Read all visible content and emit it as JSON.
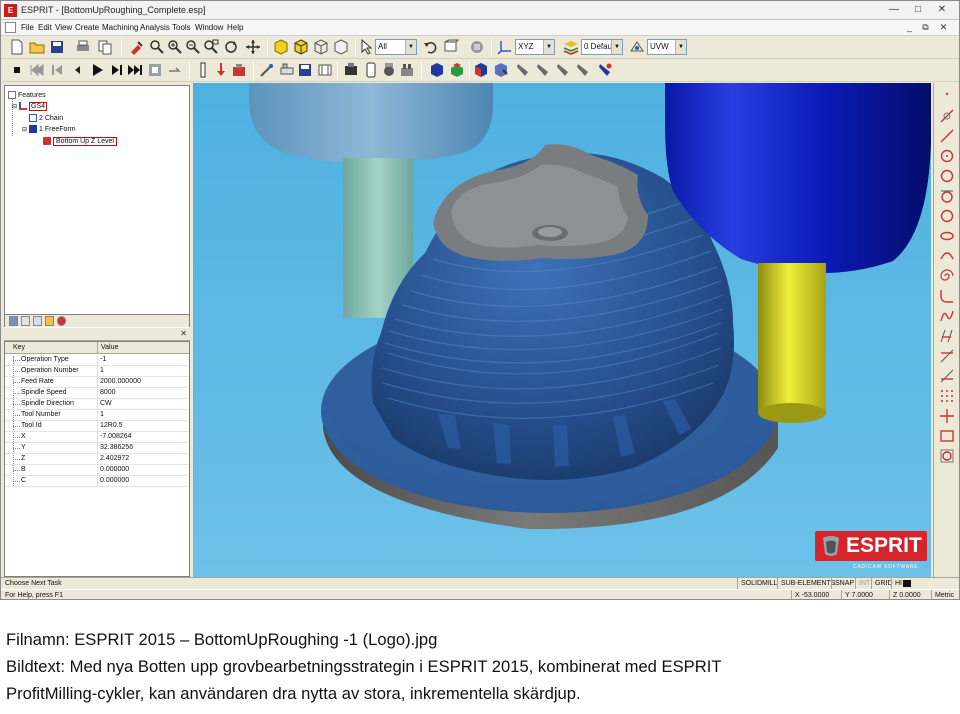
{
  "window": {
    "title": "ESPRIT - [BottomUpRoughing_Complete.esp]",
    "app_icon": "esprit-app-icon",
    "controls": [
      "minimize",
      "maximize",
      "close"
    ]
  },
  "menu": {
    "items": [
      "File",
      "Edit",
      "View",
      "Create",
      "Machining",
      "Analysis",
      "Tools",
      "Window",
      "Help"
    ]
  },
  "toolbar": {
    "filter_combo": "All",
    "plane_combo": "XYZ",
    "layer_combo": "0 Defau",
    "workplane_combo": "UVW"
  },
  "feature_tree": {
    "root": "Features",
    "nodes": [
      "GS4",
      "2 Chain",
      "1 FreeForm",
      "Bottom Up Z Level"
    ]
  },
  "property_grid": {
    "key_header": "Key",
    "value_header": "Value",
    "rows": [
      {
        "key": "Operation Type",
        "value": "-1"
      },
      {
        "key": "Operation Number",
        "value": "1"
      },
      {
        "key": "Feed Rate",
        "value": "2000.000000"
      },
      {
        "key": "Spindle Speed",
        "value": "8000"
      },
      {
        "key": "Spindle Direction",
        "value": "CW"
      },
      {
        "key": "Tool Number",
        "value": "1"
      },
      {
        "key": "Tool Id",
        "value": "12R0.5"
      },
      {
        "key": "X",
        "value": "-7.008264"
      },
      {
        "key": "Y",
        "value": "32.386256"
      },
      {
        "key": "Z",
        "value": "2.402972"
      },
      {
        "key": "B",
        "value": "0.000000"
      },
      {
        "key": "C",
        "value": "0.000000"
      }
    ]
  },
  "viewport": {
    "background": "#55b3e0",
    "logo": {
      "brand": "ESPRIT",
      "tagline": "CAD/CAM SOFTWARE"
    }
  },
  "status": {
    "prompt": "Choose Next Task",
    "help": "For Help, press F1",
    "modes": [
      "SOLIDMILL",
      "SUB-ELEMENTS",
      "SNAP",
      "INT",
      "GRID",
      "HI"
    ],
    "x": "X -53.0000",
    "y": "Y 7.0000",
    "z": "Z 0.0000",
    "units": "Metric"
  },
  "caption": {
    "filename": "Filnamn: ESPRIT 2015 – BottomUpRoughing -1 (Logo).jpg",
    "text_line1": "Bildtext: Med nya Botten upp grovbearbetningsstrategin i ESPRIT 2015, kombinerat med ESPRIT",
    "text_line2": "ProfitMilling-cykler, kan användaren dra nytta av stora, inkrementella skärdjup."
  }
}
